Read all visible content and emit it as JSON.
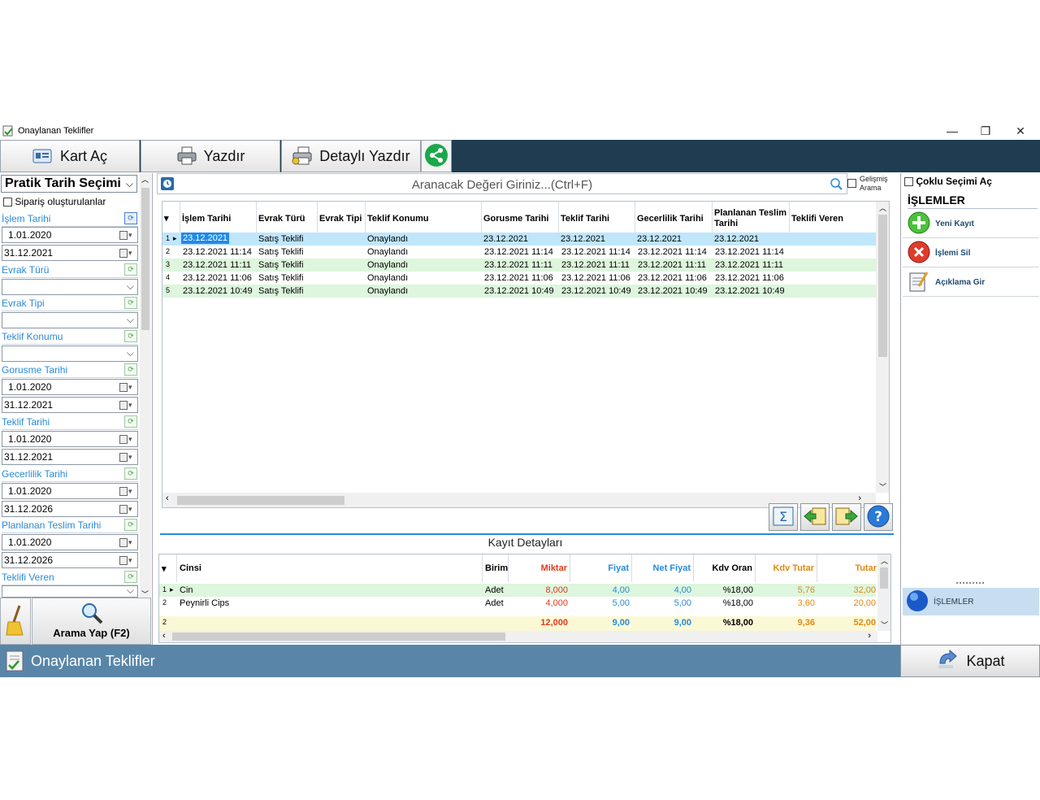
{
  "window": {
    "title": "Onaylanan Teklifler",
    "min": "—",
    "restore": "❐",
    "close": "✕"
  },
  "toolbar": {
    "kart_ac": "Kart Aç",
    "yazdir": "Yazdır",
    "detayli_yazdir": "Detaylı Yazdır"
  },
  "left": {
    "preset": "Pratik Tarih Seçimi",
    "siparis_checkbox": "Sipariş oluşturulanlar",
    "islem_tarihi": "İşlem Tarihi",
    "islem_from": "1.01.2020",
    "islem_to": "31.12.2021",
    "evrak_turu": "Evrak Türü",
    "evrak_tipi": "Evrak Tipi",
    "teklif_konumu": "Teklif Konumu",
    "gorusme_tarihi": "Gorusme Tarihi",
    "gorusme_from": "1.01.2020",
    "gorusme_to": "31.12.2021",
    "teklif_tarihi": "Teklif Tarihi",
    "teklif_from": "1.01.2020",
    "teklif_to": "31.12.2021",
    "gecerlilik_tarihi": "Gecerlilik Tarihi",
    "gecerlilik_from": "1.01.2020",
    "gecerlilik_to": "31.12.2026",
    "planlanan_teslim": "Planlanan Teslim Tarihi",
    "planlanan_from": "1.01.2020",
    "planlanan_to": "31.12.2026",
    "teklifi_veren": "Teklifi Veren",
    "search_button": "Arama Yap (F2)"
  },
  "search": {
    "placeholder": "Aranacak Değeri Giriniz...(Ctrl+F)",
    "advanced_1": "Gelişmiş",
    "advanced_2": "Arama"
  },
  "grid": {
    "headers": [
      "İşlem Tarihi",
      "Evrak Türü",
      "Evrak Tipi",
      "Teklif Konumu",
      "Gorusme Tarihi",
      "Teklif Tarihi",
      "Gecerlilik Tarihi",
      "Planlanan Teslim Tarihi",
      "Teklifi Veren"
    ],
    "rows": [
      {
        "n": "1",
        "islem": "23.12.2021",
        "evrak_turu": "Satış Teklifi",
        "evrak_tipi": "",
        "konum": "Onaylandı",
        "gorusme": "23.12.2021",
        "teklif": "23.12.2021",
        "gecerlilik": "23.12.2021",
        "planlanan": "23.12.2021",
        "veren": ""
      },
      {
        "n": "2",
        "islem": "23.12.2021 11:14",
        "evrak_turu": "Satış Teklifi",
        "evrak_tipi": "",
        "konum": "Onaylandı",
        "gorusme": "23.12.2021 11:14",
        "teklif": "23.12.2021 11:14",
        "gecerlilik": "23.12.2021 11:14",
        "planlanan": "23.12.2021 11:14",
        "veren": ""
      },
      {
        "n": "3",
        "islem": "23.12.2021 11:11",
        "evrak_turu": "Satış Teklifi",
        "evrak_tipi": "",
        "konum": "Onaylandı",
        "gorusme": "23.12.2021 11:11",
        "teklif": "23.12.2021 11:11",
        "gecerlilik": "23.12.2021 11:11",
        "planlanan": "23.12.2021 11:11",
        "veren": ""
      },
      {
        "n": "4",
        "islem": "23.12.2021 11:06",
        "evrak_turu": "Satış Teklifi",
        "evrak_tipi": "",
        "konum": "Onaylandı",
        "gorusme": "23.12.2021 11:06",
        "teklif": "23.12.2021 11:06",
        "gecerlilik": "23.12.2021 11:06",
        "planlanan": "23.12.2021 11:06",
        "veren": ""
      },
      {
        "n": "5",
        "islem": "23.12.2021 10:49",
        "evrak_turu": "Satış Teklifi",
        "evrak_tipi": "",
        "konum": "Onaylandı",
        "gorusme": "23.12.2021 10:49",
        "teklif": "23.12.2021 10:49",
        "gecerlilik": "23.12.2021 10:49",
        "planlanan": "23.12.2021 10:49",
        "veren": ""
      }
    ]
  },
  "details": {
    "title": "Kayıt Detayları",
    "headers": {
      "cinsi": "Cinsi",
      "birim": "Birim",
      "miktar": "Miktar",
      "fiyat": "Fiyat",
      "net_fiyat": "Net Fiyat",
      "kdv_oran": "Kdv Oran",
      "kdv_tutar": "Kdv Tutar",
      "tutar": "Tutar"
    },
    "rows": [
      {
        "n": "1",
        "cinsi": "Cin",
        "birim": "Adet",
        "miktar": "8,000",
        "fiyat": "4,00",
        "net_fiyat": "4,00",
        "kdv_oran": "%18,00",
        "kdv_tutar": "5,76",
        "tutar": "32,00"
      },
      {
        "n": "2",
        "cinsi": "Peynirli Cips",
        "birim": "Adet",
        "miktar": "4,000",
        "fiyat": "5,00",
        "net_fiyat": "5,00",
        "kdv_oran": "%18,00",
        "kdv_tutar": "3,60",
        "tutar": "20,00"
      }
    ],
    "total": {
      "n": "2",
      "miktar": "12,000",
      "fiyat": "9,00",
      "net_fiyat": "9,00",
      "kdv_oran": "%18,00",
      "kdv_tutar": "9,36",
      "tutar": "52,00"
    }
  },
  "right": {
    "multi_select": "Çoklu Seçimi Aç",
    "ops_title": "İŞLEMLER",
    "new_record": "Yeni Kayıt",
    "delete": "İşlemi Sil",
    "note": "Açıklama Gir",
    "ops_tab": "İŞLEMLER"
  },
  "bottom": {
    "title": "Onaylanan Teklifler",
    "close": "Kapat"
  },
  "colors": {
    "toolbar_bg": "#1f3c50",
    "bottom_bg": "#5986a8",
    "row_alt": "#ddf6dd",
    "row_selected": "#bfe6fb",
    "label_blue": "#2a8ad8"
  }
}
